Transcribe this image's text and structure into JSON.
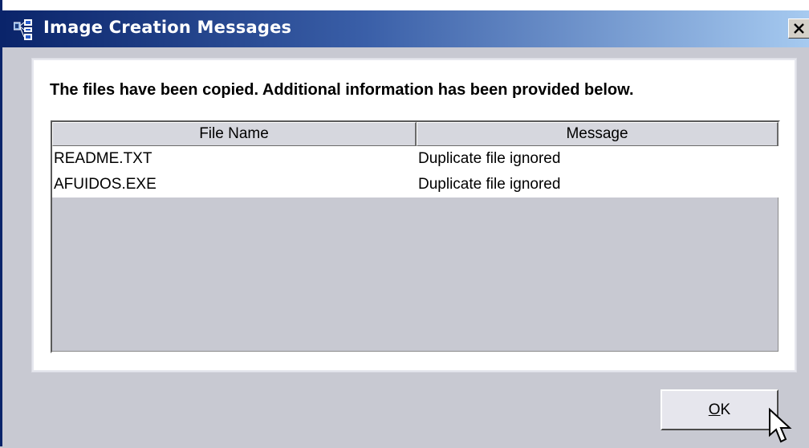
{
  "window": {
    "title": "Image Creation Messages",
    "close_glyph": "✕"
  },
  "panel": {
    "heading": "The files have been copied.  Additional information has been provided below."
  },
  "table": {
    "columns": [
      "File Name",
      "Message"
    ],
    "rows": [
      {
        "file": "README.TXT",
        "message": "Duplicate file ignored"
      },
      {
        "file": "AFUIDOS.EXE",
        "message": "Duplicate file ignored"
      }
    ]
  },
  "buttons": {
    "ok_mnemonic": "O",
    "ok_rest": "K"
  },
  "colors": {
    "title_start": "#0a246a",
    "title_end": "#a6caf0",
    "background": "#c8c9d2"
  },
  "icons": {
    "app": "network-app-icon",
    "close": "close-icon",
    "cursor": "mouse-pointer-icon"
  }
}
